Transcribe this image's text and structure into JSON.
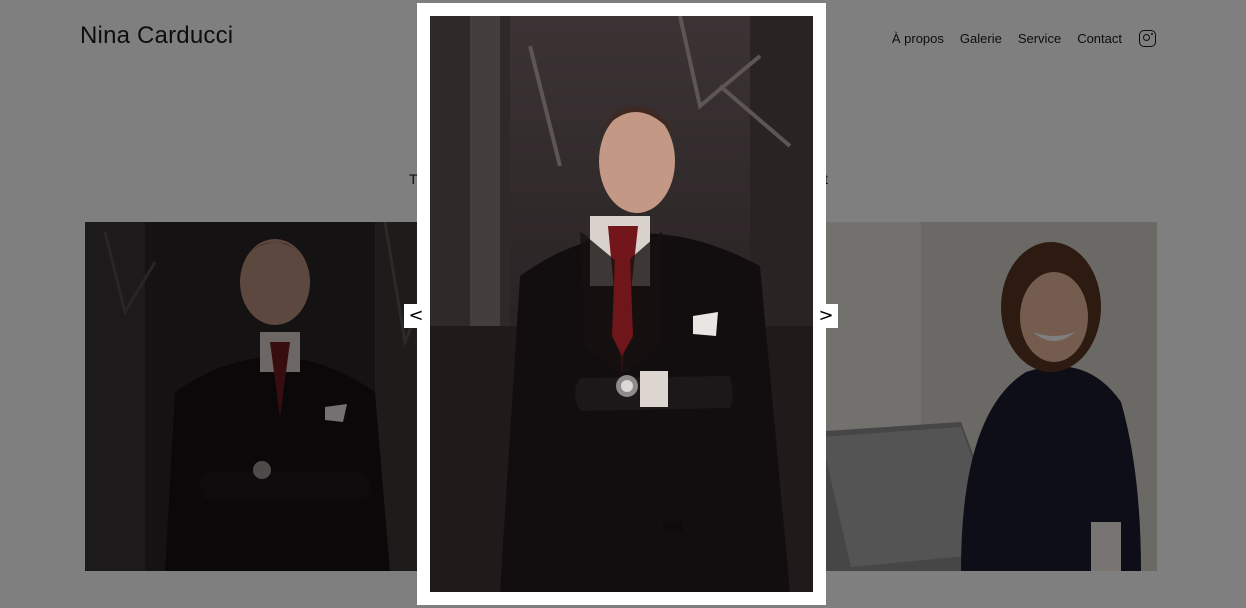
{
  "header": {
    "brand": "Nina Carducci",
    "nav": [
      "À propos",
      "Galerie",
      "Service",
      "Contact"
    ],
    "social_icon": "instagram-icon"
  },
  "intro": {
    "left_fragment": "T",
    "right_fragment": "it"
  },
  "gallery": {
    "images": [
      "man-in-suit-photo",
      "woman-laughing-laptop-photo"
    ]
  },
  "lightbox": {
    "image": "man-in-suit-photo",
    "prev_label": "<",
    "next_label": ">"
  }
}
